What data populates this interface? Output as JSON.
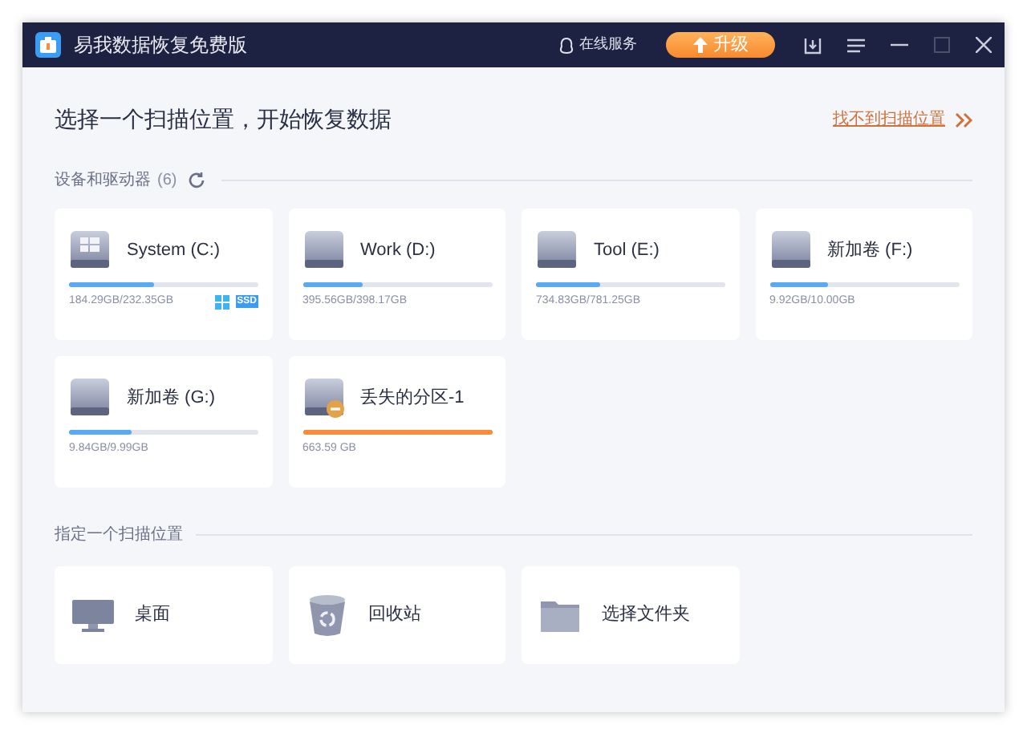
{
  "window": {
    "title": "易我数据恢复免费版"
  },
  "titlebar": {
    "service": "在线服务",
    "upgrade": "升级"
  },
  "heading": "选择一个扫描位置，开始恢复数据",
  "help_link": "找不到扫描位置",
  "drives_section": {
    "title": "设备和驱动器",
    "count": "(6)"
  },
  "drives": [
    {
      "name": "System (C:)",
      "usage": "184.29GB/232.35GB",
      "level": 0.45,
      "color": "#5aa9f5",
      "kind": "system",
      "tag": "SSD"
    },
    {
      "name": "Work (D:)",
      "usage": "395.56GB/398.17GB",
      "level": 0.32,
      "color": "#5aa9f5",
      "kind": "volume"
    },
    {
      "name": "Tool (E:)",
      "usage": "734.83GB/781.25GB",
      "level": 0.34,
      "color": "#5aa9f5",
      "kind": "volume"
    },
    {
      "name": "新加卷 (F:)",
      "usage": "9.92GB/10.00GB",
      "level": 0.31,
      "color": "#5aa9f5",
      "kind": "volume"
    },
    {
      "name": "新加卷 (G:)",
      "usage": "9.84GB/9.99GB",
      "level": 0.33,
      "color": "#5aa9f5",
      "kind": "volume"
    },
    {
      "name": "丢失的分区-1",
      "usage": "663.59 GB",
      "level": 1,
      "color": "#fb8c3c",
      "kind": "lost"
    }
  ],
  "locations_section": {
    "title": "指定一个扫描位置"
  },
  "locations": [
    {
      "name": "桌面",
      "kind": "desktop"
    },
    {
      "name": "回收站",
      "kind": "recycle"
    },
    {
      "name": "选择文件夹",
      "kind": "folder"
    }
  ]
}
